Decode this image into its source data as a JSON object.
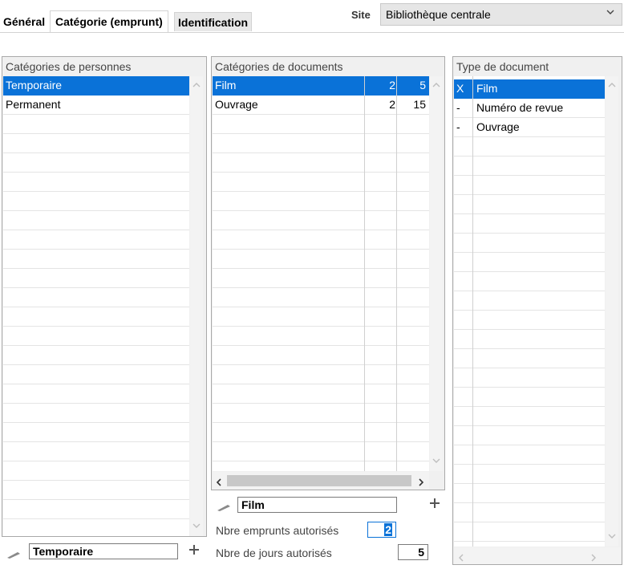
{
  "tabs": {
    "general": "Général",
    "categorie": "Catégorie (emprunt)",
    "identification": "Identification"
  },
  "site": {
    "label": "Site",
    "value": "Bibliothèque centrale"
  },
  "personnes": {
    "header": "Catégories de personnes",
    "rows": [
      "Temporaire",
      "Permanent"
    ],
    "edit_value": "Temporaire"
  },
  "documents": {
    "header": "Catégories de documents",
    "rows": [
      {
        "name": "Film",
        "emprunts": "2",
        "jours": "5"
      },
      {
        "name": "Ouvrage",
        "emprunts": "2",
        "jours": "15"
      }
    ],
    "edit_value": "Film",
    "nbre_emprunts_label": "Nbre emprunts autorisés",
    "nbre_emprunts_value": "2",
    "nbre_jours_label": "Nbre de jours autorisés",
    "nbre_jours_value": "5"
  },
  "types": {
    "header": "Type de document",
    "rows": [
      {
        "mark": "X",
        "name": "Film"
      },
      {
        "mark": "-",
        "name": "Numéro de revue"
      },
      {
        "mark": "-",
        "name": "Ouvrage"
      }
    ]
  },
  "icons": {
    "scroll_up": "scroll-up-icon",
    "scroll_down": "scroll-down-icon",
    "scroll_left": "scroll-left-icon",
    "scroll_right": "scroll-right-icon",
    "edit": "pencil-icon",
    "add": "plus-icon",
    "dropdown": "chevron-down-icon"
  },
  "colors": {
    "selection": "#0a72d8"
  }
}
